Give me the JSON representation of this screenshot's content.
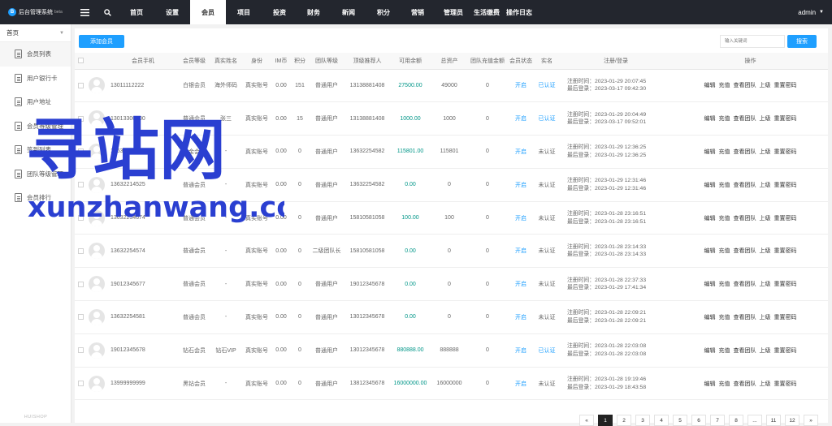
{
  "app": {
    "title": "后台管理系统",
    "version": "beta",
    "logo_letter": "B"
  },
  "nav": {
    "items": [
      "首页",
      "设置",
      "会员",
      "项目",
      "投资",
      "财务",
      "新闻",
      "积分",
      "营销",
      "管理员",
      "生活缴费",
      "操作日志"
    ],
    "active_index": 2
  },
  "user": {
    "name": "admin"
  },
  "sidebar": {
    "header": "首页",
    "items": [
      "会员列表",
      "用户银行卡",
      "用户地址",
      "会员等级管理",
      "签到列表",
      "团队等级管理",
      "会员排行"
    ],
    "active_index": 0,
    "footer": "HUISHOP"
  },
  "toolbar": {
    "add_label": "添加会员",
    "search_placeholder": "输入关键词",
    "search_label": "搜索"
  },
  "table": {
    "headers": [
      "",
      "",
      "会员手机",
      "会员等级",
      "真实姓名",
      "身份",
      "IM币",
      "积分",
      "团队等级",
      "顶级推荐人",
      "可用余额",
      "总资产",
      "团队充值金额",
      "会员状态",
      "实名",
      "注册/登录",
      "操作"
    ],
    "rows": [
      {
        "phone": "13011112222",
        "level": "白银会员",
        "name": "海外师码",
        "identity": "真实账号",
        "im": "0.00",
        "points": "151",
        "team": "普通用户",
        "referrer": "13138881408",
        "balance": "27500.00",
        "assets": "49000",
        "team_charge": "0",
        "status": "开启",
        "realname": "已认证",
        "reg": "注册时间：2023-01-29 20:07:45",
        "login": "最后登录：2023-03-17 09:42:30"
      },
      {
        "phone": "13013300000",
        "level": "普通会员",
        "name": "张三",
        "identity": "真实账号",
        "im": "0.00",
        "points": "15",
        "team": "普通用户",
        "referrer": "13138881408",
        "balance": "1000.00",
        "assets": "1000",
        "team_charge": "0",
        "status": "开启",
        "realname": "已认证",
        "reg": "注册时间：2023-01-29 20:04:49",
        "login": "最后登录：2023-03-17 09:52:01"
      },
      {
        "phone": "13632345785",
        "level": "黄金会员",
        "name": "-",
        "identity": "真实账号",
        "im": "0.00",
        "points": "0",
        "team": "普通用户",
        "referrer": "13632254582",
        "balance": "115801.00",
        "assets": "115801",
        "team_charge": "0",
        "status": "开启",
        "realname": "未认证",
        "reg": "注册时间：2023-01-29 12:36:25",
        "login": "最后登录：2023-01-29 12:36:25"
      },
      {
        "phone": "13632214525",
        "level": "普通会员",
        "name": "-",
        "identity": "真实账号",
        "im": "0.00",
        "points": "0",
        "team": "普通用户",
        "referrer": "13632254582",
        "balance": "0.00",
        "assets": "0",
        "team_charge": "0",
        "status": "开启",
        "realname": "未认证",
        "reg": "注册时间：2023-01-29 12:31:46",
        "login": "最后登录：2023-01-29 12:31:46"
      },
      {
        "phone": "13632254674",
        "level": "普通会员",
        "name": "-",
        "identity": "真实账号",
        "im": "0.00",
        "points": "0",
        "team": "普通用户",
        "referrer": "15810581058",
        "balance": "100.00",
        "assets": "100",
        "team_charge": "0",
        "status": "开启",
        "realname": "未认证",
        "reg": "注册时间：2023-01-28 23:16:51",
        "login": "最后登录：2023-01-28 23:16:51"
      },
      {
        "phone": "13632254574",
        "level": "普通会员",
        "name": "-",
        "identity": "真实账号",
        "im": "0.00",
        "points": "0",
        "team": "二级团队长",
        "referrer": "15810581058",
        "balance": "0.00",
        "assets": "0",
        "team_charge": "0",
        "status": "开启",
        "realname": "未认证",
        "reg": "注册时间：2023-01-28 23:14:33",
        "login": "最后登录：2023-01-28 23:14:33"
      },
      {
        "phone": "19012345677",
        "level": "普通会员",
        "name": "-",
        "identity": "真实账号",
        "im": "0.00",
        "points": "0",
        "team": "普通用户",
        "referrer": "19012345678",
        "balance": "0.00",
        "assets": "0",
        "team_charge": "0",
        "status": "开启",
        "realname": "未认证",
        "reg": "注册时间：2023-01-28 22:37:33",
        "login": "最后登录：2023-01-29 17:41:34"
      },
      {
        "phone": "13632254581",
        "level": "普通会员",
        "name": "-",
        "identity": "真实账号",
        "im": "0.00",
        "points": "0",
        "team": "普通用户",
        "referrer": "13012345678",
        "balance": "0.00",
        "assets": "0",
        "team_charge": "0",
        "status": "开启",
        "realname": "未认证",
        "reg": "注册时间：2023-01-28 22:09:21",
        "login": "最后登录：2023-01-28 22:09:21"
      },
      {
        "phone": "19012345678",
        "level": "钻石会员",
        "name": "钻石VIP",
        "identity": "真实账号",
        "im": "0.00",
        "points": "0",
        "team": "普通用户",
        "referrer": "13012345678",
        "balance": "880888.00",
        "assets": "888888",
        "team_charge": "0",
        "status": "开启",
        "realname": "已认证",
        "reg": "注册时间：2023-01-28 22:03:08",
        "login": "最后登录：2023-01-28 22:03:08"
      },
      {
        "phone": "13999999999",
        "level": "黑钻会员",
        "name": "-",
        "identity": "真实账号",
        "im": "0.00",
        "points": "0",
        "team": "普通用户",
        "referrer": "13812345678",
        "balance": "16000000.00",
        "assets": "16000000",
        "team_charge": "0",
        "status": "开启",
        "realname": "未认证",
        "reg": "注册时间：2023-01-28 19:19:46",
        "login": "最后登录：2023-01-29 18:43:58"
      }
    ],
    "actions": [
      "编辑",
      "充值",
      "查看团队",
      "上级",
      "重置密码"
    ]
  },
  "pagination": {
    "prev": "«",
    "pages": [
      "1",
      "2",
      "3",
      "4",
      "5",
      "6",
      "7",
      "8",
      "...",
      "11",
      "12",
      "»"
    ],
    "active_index": 0
  },
  "watermark": {
    "text_cn": "寻站网",
    "text_en": "xunzhanwang.com",
    "color": "#2a3fd1"
  },
  "colors": {
    "topbar": "#23262e",
    "accent": "#1e9fff",
    "money": "#009688"
  }
}
